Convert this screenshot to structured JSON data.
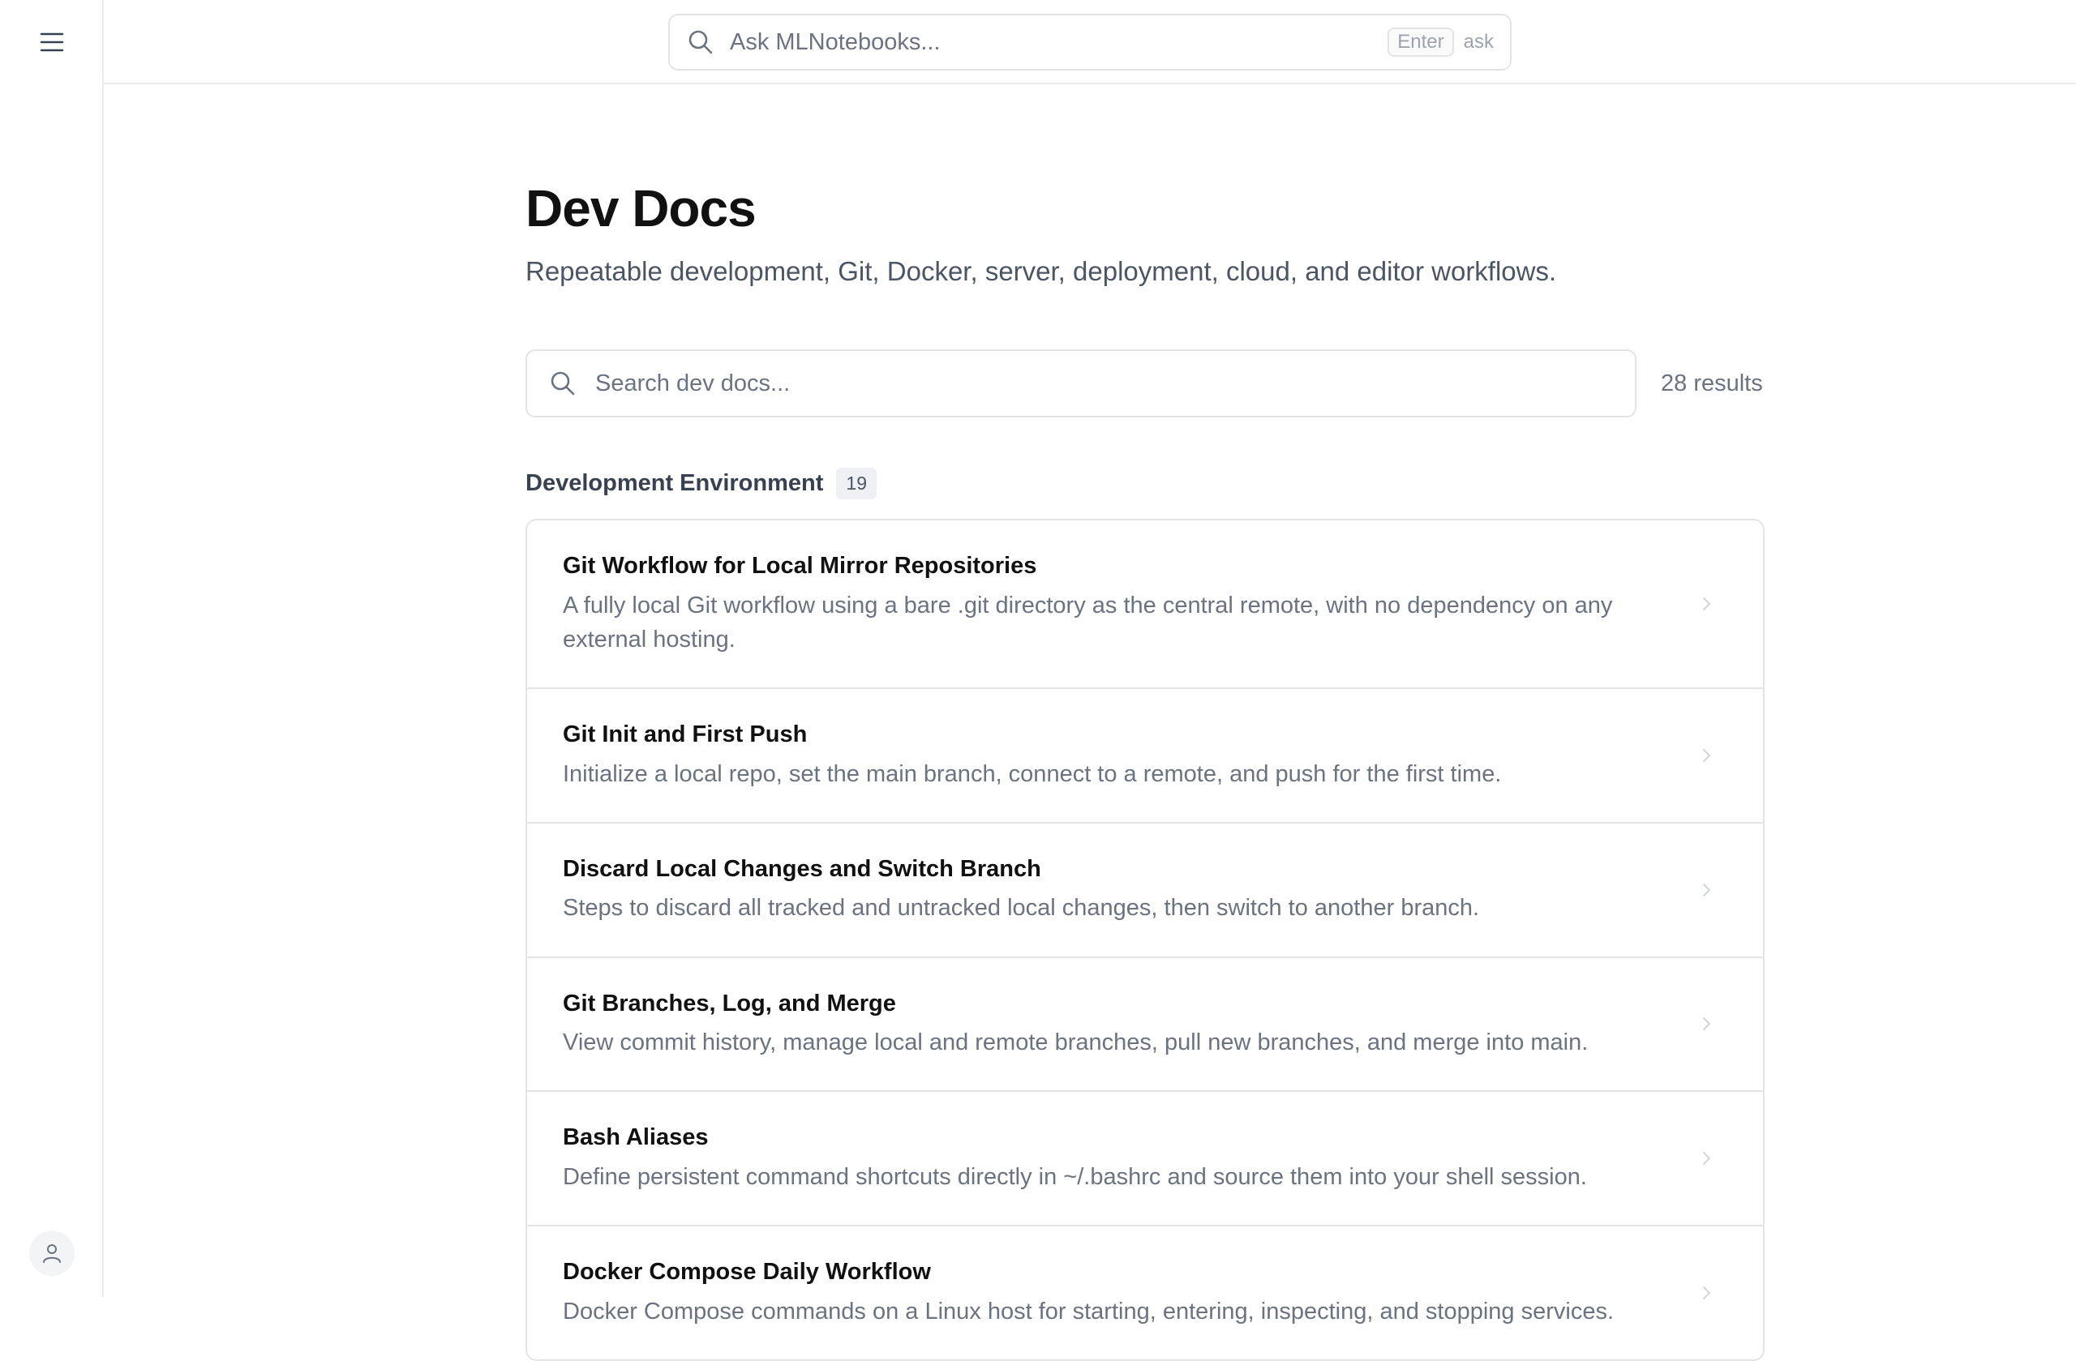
{
  "topbar": {
    "ask_placeholder": "Ask MLNotebooks...",
    "kbd_label": "Enter",
    "kbd_hint": "ask"
  },
  "page": {
    "title": "Dev Docs",
    "subtitle": "Repeatable development, Git, Docker, server, deployment, cloud, and editor workflows."
  },
  "search": {
    "placeholder": "Search dev docs...",
    "result_count": "28 results"
  },
  "section": {
    "title": "Development Environment",
    "count": "19",
    "items": [
      {
        "title": "Git Workflow for Local Mirror Repositories",
        "description": "A fully local Git workflow using a bare .git directory as the central remote, with no dependency on any external hosting."
      },
      {
        "title": "Git Init and First Push",
        "description": "Initialize a local repo, set the main branch, connect to a remote, and push for the first time."
      },
      {
        "title": "Discard Local Changes and Switch Branch",
        "description": "Steps to discard all tracked and untracked local changes, then switch to another branch."
      },
      {
        "title": "Git Branches, Log, and Merge",
        "description": "View commit history, manage local and remote branches, pull new branches, and merge into main."
      },
      {
        "title": "Bash Aliases",
        "description": "Define persistent command shortcuts directly in ~/.bashrc and source them into your shell session."
      },
      {
        "title": "Docker Compose Daily Workflow",
        "description": "Docker Compose commands on a Linux host for starting, entering, inspecting, and stopping services."
      }
    ]
  },
  "icons": {
    "menu": "menu-icon",
    "search": "search-icon",
    "user": "user-icon",
    "chevron": "chevron-right-icon"
  },
  "colors": {
    "text_primary": "#111111",
    "text_muted": "#6b7280",
    "border": "#e4e4e7",
    "badge_bg": "#eef0f3"
  }
}
